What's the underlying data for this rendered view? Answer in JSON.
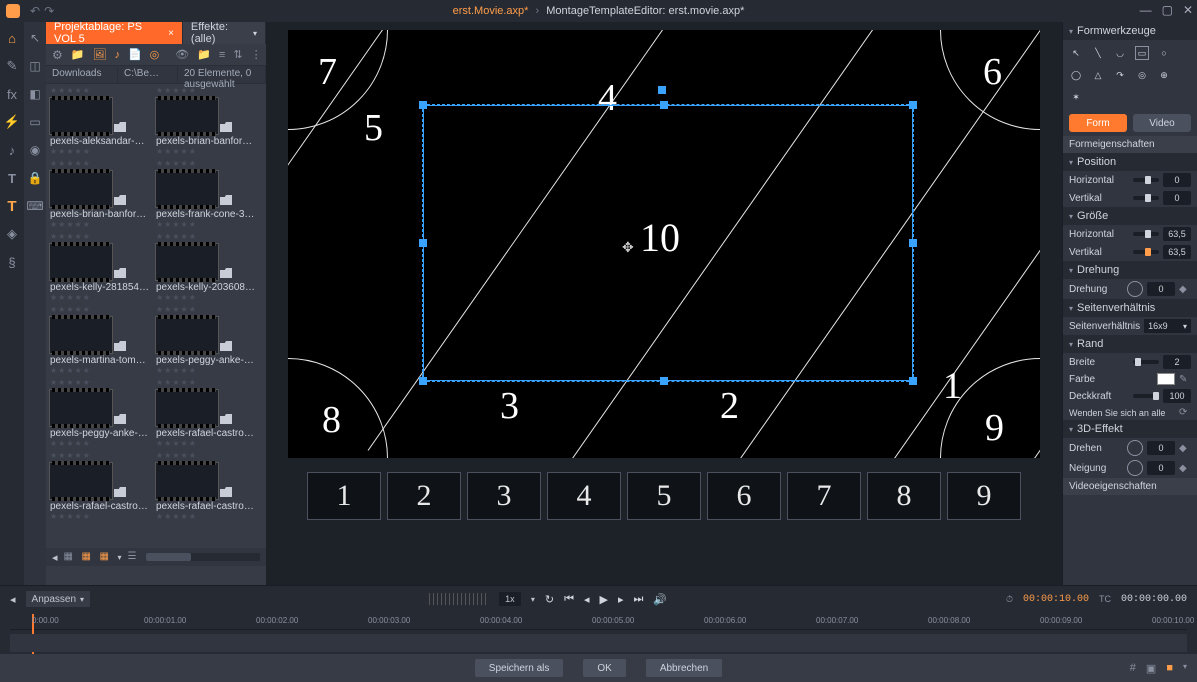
{
  "titlebar": {
    "crumb1": "erst.Movie.axp*",
    "crumb2": "MontageTemplateEditor: erst.movie.axp*"
  },
  "browser": {
    "tab_active": "Projektablage: PS VOL 5",
    "tab_other": "Effekte: (alle)",
    "col_downloads": "Downloads",
    "col_path": "C:\\Be…",
    "col_status": "20 Elemente, 0 ausgewählt",
    "items": [
      {
        "name": "pexels-aleksandar-p…"
      },
      {
        "name": "pexels-brian-banfor…"
      },
      {
        "name": "pexels-brian-banfor…"
      },
      {
        "name": "pexels-frank-cone-3…"
      },
      {
        "name": "pexels-kelly-281854…"
      },
      {
        "name": "pexels-kelly-203608…"
      },
      {
        "name": "pexels-martina-tom&…"
      },
      {
        "name": "pexels-peggy-anke-…"
      },
      {
        "name": "pexels-peggy-anke-…"
      },
      {
        "name": "pexels-rafael-castro-…"
      },
      {
        "name": "pexels-rafael-castro-…"
      },
      {
        "name": "pexels-rafael-castro-…"
      }
    ]
  },
  "canvas": {
    "nums": [
      "7",
      "5",
      "4",
      "6",
      "8",
      "3",
      "2",
      "1",
      "9"
    ],
    "center": "10"
  },
  "keyframes": [
    "1",
    "2",
    "3",
    "4",
    "5",
    "6",
    "7",
    "8",
    "9"
  ],
  "props": {
    "title": "Formwerkzeuge",
    "btn_form": "Form",
    "btn_video": "Video",
    "formeig": "Formeigenschaften",
    "position": "Position",
    "hor": "Horizontal",
    "ver": "Vertikal",
    "groesse": "Größe",
    "gh": "63,5",
    "gv": "63,5",
    "drehung": "Drehung",
    "drehung_lbl": "Drehung",
    "seit": "Seitenverhältnis",
    "seit_lbl": "Seitenverhältnis",
    "seit_val": "16x9",
    "rand": "Rand",
    "breite": "Breite",
    "breite_v": "2",
    "farbe": "Farbe",
    "deck": "Deckkraft",
    "deck_v": "100",
    "wenden": "Wenden Sie sich an alle",
    "d3": "3D-Effekt",
    "drehen": "Drehen",
    "neigung": "Neigung",
    "videoeig": "Videoeigenschaften",
    "zero": "0"
  },
  "transport": {
    "anpassen": "Anpassen",
    "zoom": "1x",
    "tc1": "00:00:10.00",
    "tc2": "00:00:00.00",
    "ticks": [
      "0:00.00",
      "00:00:01.00",
      "00:00:02.00",
      "00:00:03.00",
      "00:00:04.00",
      "00:00:05.00",
      "00:00:06.00",
      "00:00:07.00",
      "00:00:08.00",
      "00:00:09.00",
      "00:00:10.00"
    ]
  },
  "dialog": {
    "save": "Speichern als",
    "ok": "OK",
    "cancel": "Abbrechen"
  }
}
